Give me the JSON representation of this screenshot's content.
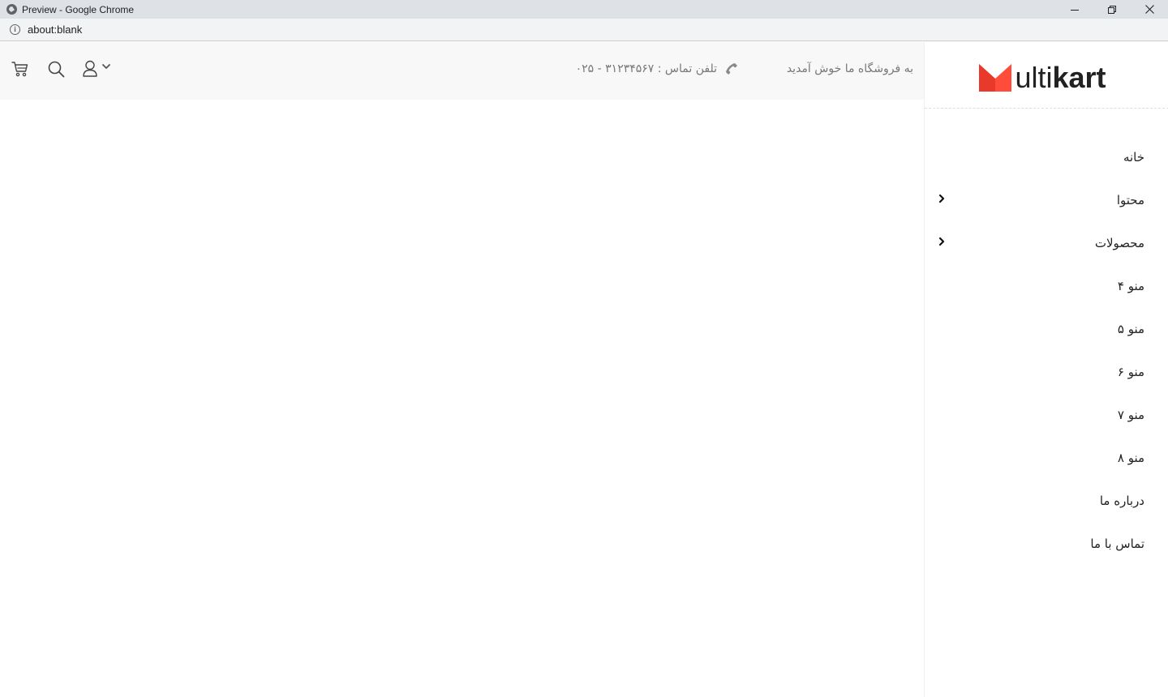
{
  "window": {
    "title": "Preview - Google Chrome",
    "minimize": "—",
    "restore": "❐",
    "close": "✕"
  },
  "address": {
    "url": "about:blank"
  },
  "header": {
    "welcome": "به فروشگاه ما خوش آمدید",
    "phone": "تلفن تماس : ۳۱۲۳۴۵۶۷ - ۰۲۵"
  },
  "logo": {
    "text_light": "ulti",
    "text_bold": "kart",
    "accent_color": "#ff4c3b"
  },
  "menu": [
    {
      "label": "خانه",
      "has_submenu": false
    },
    {
      "label": "محتوا",
      "has_submenu": true
    },
    {
      "label": "محصولات",
      "has_submenu": true
    },
    {
      "label": "منو ۴",
      "has_submenu": false
    },
    {
      "label": "منو ۵",
      "has_submenu": false
    },
    {
      "label": "منو ۶",
      "has_submenu": false
    },
    {
      "label": "منو ۷",
      "has_submenu": false
    },
    {
      "label": "منو ۸",
      "has_submenu": false
    },
    {
      "label": "درباره ما",
      "has_submenu": false
    },
    {
      "label": "تماس با ما",
      "has_submenu": false
    }
  ],
  "icons": {
    "cart": "cart-icon",
    "search": "search-icon",
    "user": "user-icon",
    "user_dropdown": "chevron-down-icon",
    "phone": "phone-icon",
    "submenu": "chevron-right-icon"
  }
}
